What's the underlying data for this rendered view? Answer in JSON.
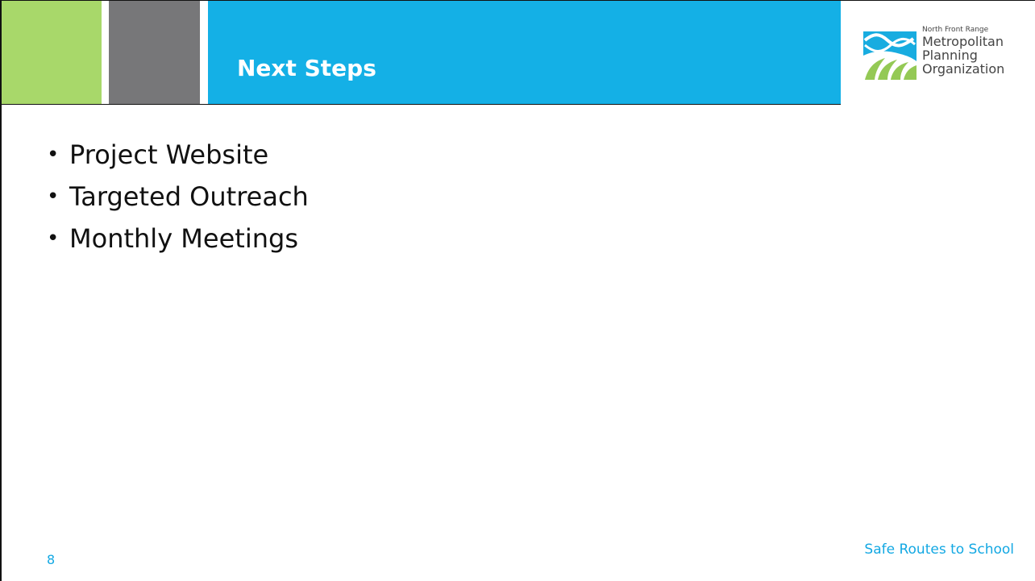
{
  "slide": {
    "title": "Next Steps",
    "bullets": [
      "Project Website",
      "Targeted Outreach",
      "Monthly Meetings"
    ],
    "page_number": "8",
    "footer": "Safe Routes to School"
  },
  "logo": {
    "line_1": "North Front Range",
    "line_2": "Metropolitan",
    "line_3": "Planning",
    "line_4": "Organization",
    "icon": "nfrmpo-logo-icon"
  },
  "colors": {
    "green": "#a8d86a",
    "gray": "#777779",
    "blue": "#14b0e6",
    "accent_text": "#13a8e3"
  }
}
